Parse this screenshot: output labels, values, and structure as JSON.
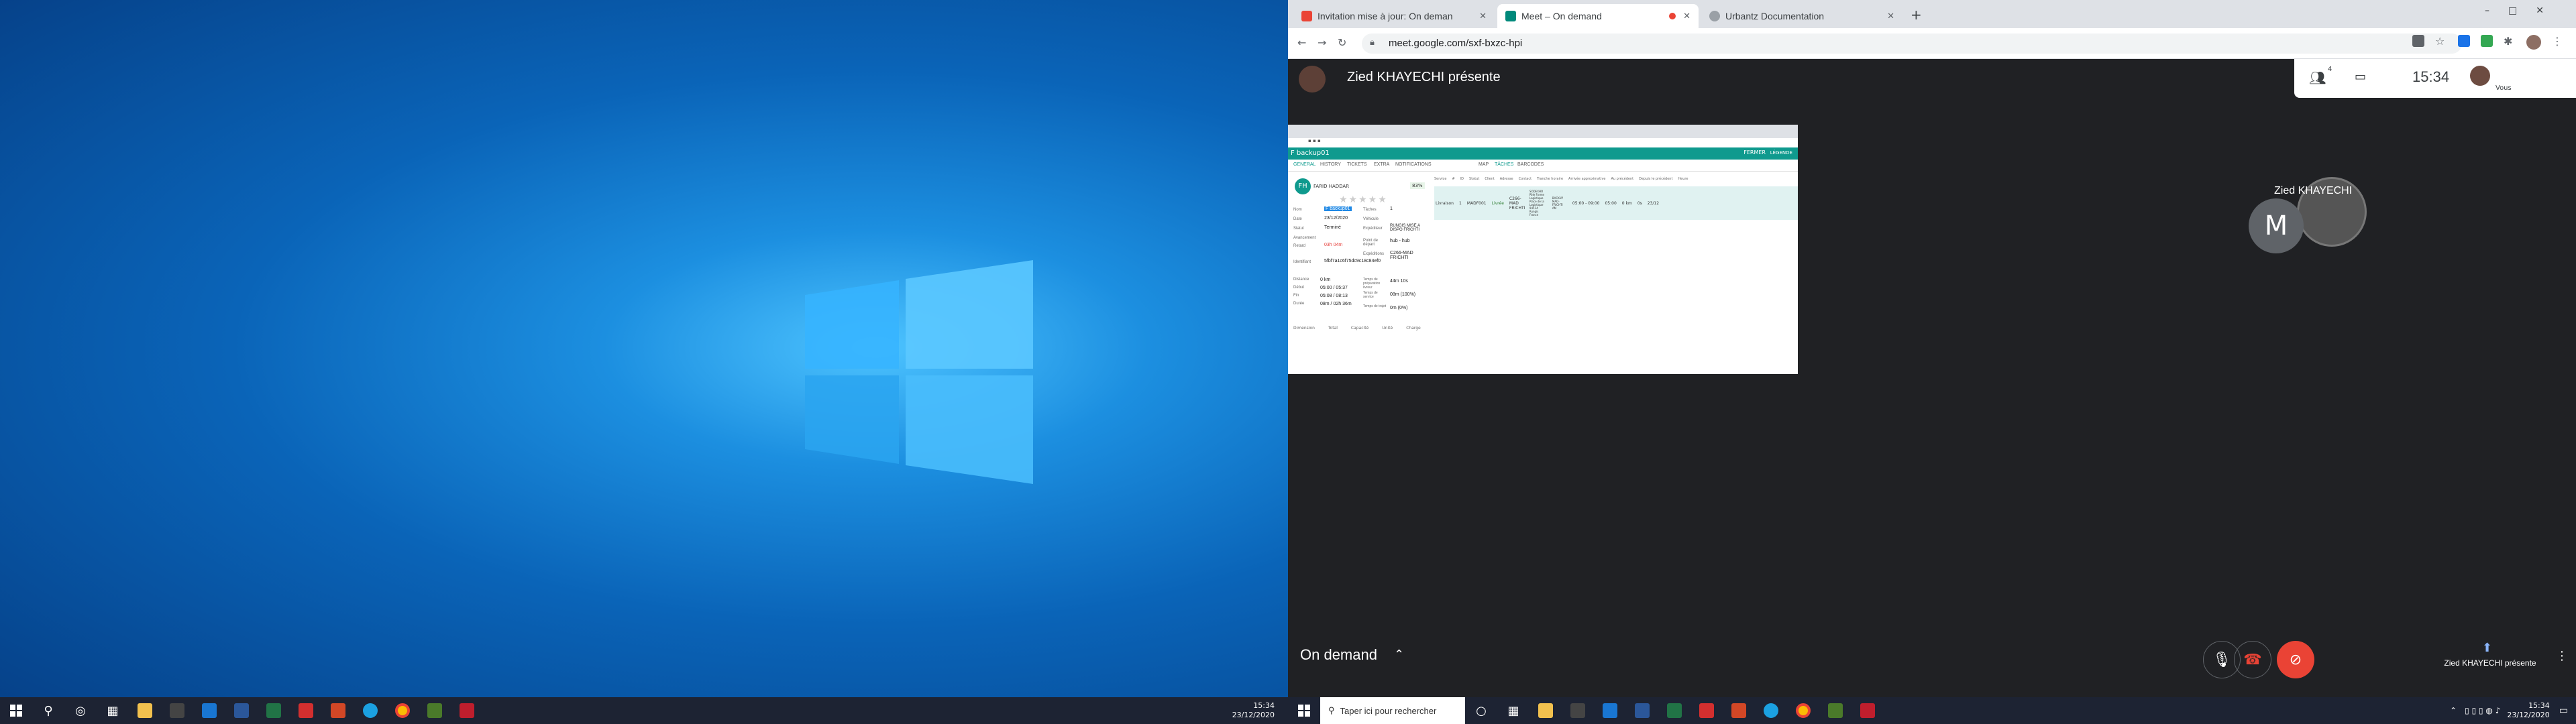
{
  "left_screen": {
    "clock_time": "15:34",
    "clock_date": "23/12/2020"
  },
  "browser": {
    "tabs": [
      {
        "label": "Invitation mise à jour: On deman",
        "icon": "gmail-icon"
      },
      {
        "label": "Meet – On demand",
        "icon": "meet-icon"
      },
      {
        "label": "Urbantz Documentation",
        "icon": "globe-icon"
      }
    ],
    "new_tab_label": "+",
    "url": "meet.google.com/sxf-bxzc-hpi"
  },
  "meet": {
    "presenter_title": "Zied KHAYECHI présente",
    "participants_badge": "4",
    "time": "15:34",
    "you_label": "Vous",
    "participant_name": "Zied KHAYECHI",
    "avatar_letter": "M",
    "meeting_name": "On demand",
    "presenting_label": "Zied KHAYECHI présente",
    "colors": {
      "end_call": "#ea4335",
      "camera_off": "#ea4335",
      "accent_teal": "#0f9a8e"
    }
  },
  "shared_screen": {
    "header_title": "F backup01",
    "close_label": "FERMER",
    "legend_label": "LÉGENDE",
    "left_tabs": [
      "GENERAL",
      "HISTORY",
      "TICKETS",
      "EXTRA",
      "NOTIFICATIONS"
    ],
    "right_tabs": [
      "MAP",
      "TÂCHES",
      "BARCODES"
    ],
    "driver_initials": "FH",
    "driver_name": "FARID HADDAR",
    "battery": "83%",
    "fields_left": [
      {
        "label": "Nom",
        "value": "F backup01"
      },
      {
        "label": "Date",
        "value": "23/12/2020"
      },
      {
        "label": "Statut",
        "value": "Terminé"
      },
      {
        "label": "Avancement",
        "value": ""
      },
      {
        "label": "Retard",
        "value": "03h 04m"
      },
      {
        "label": "Identifiant",
        "value": "5fbf7a1c6f75dc9c18c84ef0"
      }
    ],
    "fields_right": [
      {
        "label": "Tâches",
        "value": "1"
      },
      {
        "label": "Véhicule",
        "value": ""
      },
      {
        "label": "Expéditeur",
        "value": "RUNGIS MISE A DISPO FRICHTI"
      },
      {
        "label": "Point de départ",
        "value": "hub - hub"
      },
      {
        "label": "Expéditions",
        "value": "C266-MAD FRICHTI"
      }
    ],
    "stats_left": [
      {
        "label": "Distance",
        "value": "0 km"
      },
      {
        "label": "Début",
        "value": "05:00 / 05:37"
      },
      {
        "label": "Fin",
        "value": "05:08 / 08:13"
      },
      {
        "label": "Durée",
        "value": "08m / 02h 36m"
      }
    ],
    "stats_right": [
      {
        "label": "Temps de préparation livreur",
        "value": "44m 10s"
      },
      {
        "label": "Temps de service",
        "value": "08m (100%)"
      },
      {
        "label": "Temps de trajet",
        "value": "0m (0%)"
      }
    ],
    "bottom_headers": [
      "Dimension",
      "Total",
      "Capacité",
      "Unité",
      "Charge"
    ],
    "table_headers": [
      "Service",
      "#",
      "ID",
      "Statut",
      "Client",
      "Adresse",
      "Contact",
      "Tranche horaire",
      "Arrivée approximative",
      "Au précédent",
      "Depuis le précédent",
      "Heure"
    ],
    "table_row": [
      "Livraison",
      "1",
      "MADF001",
      "Livrée",
      "C266-MAD FRICHTI",
      "SODEXHO Pôle Forme Logistique Place de la Logistique 94514 Rungis France",
      "BACKUP MAD-FRICHTI AM",
      "05:00 - 09:00",
      "05:00",
      "0 km",
      "0s",
      "23/12"
    ]
  },
  "right_taskbar": {
    "search_placeholder": "Taper ici pour rechercher",
    "clock_time": "15:34",
    "clock_date": "23/12/2020"
  }
}
